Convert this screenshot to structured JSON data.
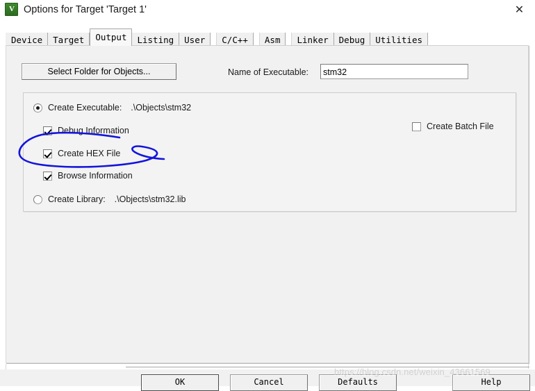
{
  "window": {
    "title": "Options for Target 'Target 1'",
    "icon": "uvision-logo-icon",
    "close_label": "✕"
  },
  "tabs": [
    {
      "label": "Device",
      "active": false
    },
    {
      "label": "Target",
      "active": false
    },
    {
      "label": "Output",
      "active": true
    },
    {
      "label": "Listing",
      "active": false
    },
    {
      "label": "User",
      "active": false
    },
    {
      "label": "C/C++",
      "active": false
    },
    {
      "label": "Asm",
      "active": false
    },
    {
      "label": "Linker",
      "active": false
    },
    {
      "label": "Debug",
      "active": false
    },
    {
      "label": "Utilities",
      "active": false
    }
  ],
  "output": {
    "select_folder_button": "Select Folder for Objects...",
    "executable_label": "Name of Executable:",
    "executable_value": "stm32",
    "executable_placeholder": "",
    "create_executable": {
      "label": "Create Executable:",
      "path": ".\\Objects\\stm32",
      "checked": true
    },
    "debug_information": {
      "label": "Debug Information",
      "checked": true
    },
    "create_hex_file": {
      "label": "Create HEX File",
      "checked": true
    },
    "browse_information": {
      "label": "Browse Information",
      "checked": true
    },
    "create_library": {
      "label": "Create Library:",
      "path": ".\\Objects\\stm32.lib",
      "checked": false
    },
    "create_batch_file": {
      "label": "Create Batch File",
      "checked": false
    }
  },
  "annotation": {
    "type": "hand-drawn-ellipse",
    "target": "Create HEX File",
    "color": "#1414dc"
  },
  "footer": {
    "ok": "OK",
    "cancel": "Cancel",
    "defaults": "Defaults",
    "help": "Help"
  },
  "watermark": {
    "text": "https://blog.csdn.net/weixin_43661569"
  }
}
